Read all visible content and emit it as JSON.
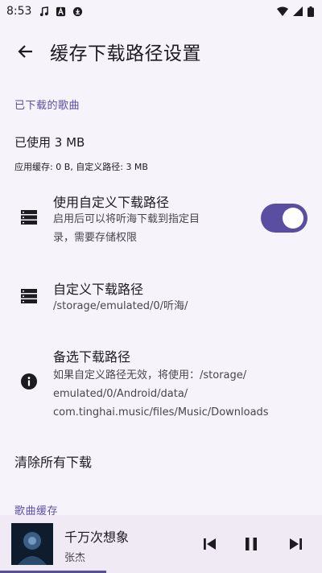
{
  "status_bar": {
    "time": "8:53",
    "icons": [
      "music-note-icon",
      "font-a-icon",
      "download-circle-icon"
    ],
    "right_icons": [
      "wifi-icon",
      "signal-icon",
      "battery-icon"
    ]
  },
  "app_bar": {
    "title": "缓存下载路径设置",
    "back_icon": "arrow-left-icon"
  },
  "downloaded": {
    "section_header": "已下载的歌曲",
    "used": "已使用 3 MB",
    "detail": "应用缓存: 0 B, 自定义路径: 3 MB"
  },
  "custom_path_toggle": {
    "title": "使用自定义下载路径",
    "subtitle_line1": "启用后可以将听海下载到指定目",
    "subtitle_line2": "录，需要存储权限",
    "enabled": true,
    "icon": "storage-icon"
  },
  "custom_path": {
    "title": "自定义下载路径",
    "value": "/storage/emulated/0/听海/",
    "icon": "storage-icon"
  },
  "fallback_path": {
    "title": "备选下载路径",
    "line1": "如果自定义路径无效，将使用：/storage/",
    "line2": "emulated/0/Android/data/",
    "line3": "com.tinghai.music/files/Music/Downloads",
    "icon": "info-icon"
  },
  "clear_all": {
    "label": "清除所有下载"
  },
  "song_cache": {
    "section_header": "歌曲缓存"
  },
  "player": {
    "title": "千万次想象",
    "artist": "张杰",
    "controls": [
      "skip-previous-icon",
      "pause-icon",
      "skip-next-icon"
    ],
    "progress": 0.33,
    "accent": "#5a4ea3"
  }
}
